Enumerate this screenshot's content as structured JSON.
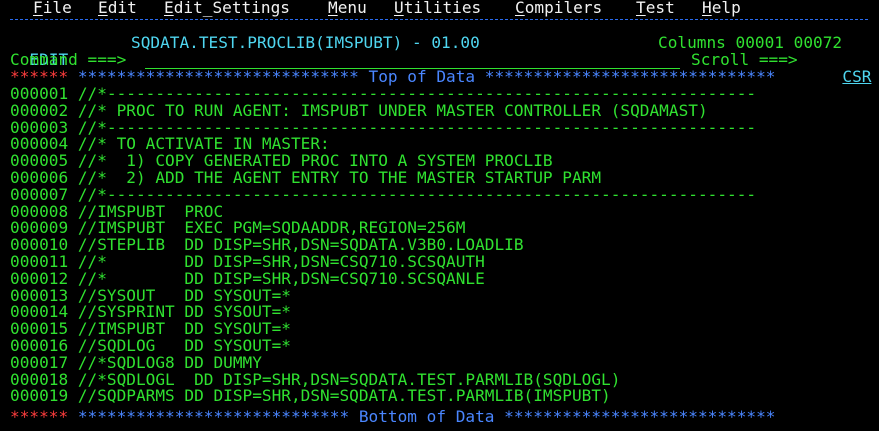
{
  "menubar": {
    "items": [
      {
        "mnemonic": "F",
        "rest": "ile"
      },
      {
        "mnemonic": "E",
        "rest": "dit"
      },
      {
        "mnemonic": "E",
        "rest": "dit_Settings"
      },
      {
        "mnemonic": "M",
        "rest": "enu"
      },
      {
        "mnemonic": "U",
        "rest": "tilities"
      },
      {
        "mnemonic": "C",
        "rest": "ompilers"
      },
      {
        "mnemonic": "T",
        "rest": "est"
      },
      {
        "mnemonic": "H",
        "rest": "elp"
      }
    ]
  },
  "header": {
    "mode": "EDIT",
    "dataset": "SQDATA.TEST.PROCLIB(IMSPUBT) - 01.00",
    "columns": "Columns 00001 00072",
    "command_label": "Command ===>",
    "command_value": "",
    "scroll_label": "Scroll ===>",
    "scroll_value": "CSR"
  },
  "markers": {
    "stars": "******",
    "top_line": " ***************************** Top of Data ******************************",
    "bottom_line": " **************************** Bottom of Data ****************************"
  },
  "lines": [
    {
      "num": "000001",
      "text": " //*-------------------------------------------------------------------"
    },
    {
      "num": "000002",
      "text": " //* PROC TO RUN AGENT: IMSPUBT UNDER MASTER CONTROLLER (SQDAMAST)"
    },
    {
      "num": "000003",
      "text": " //*-------------------------------------------------------------------"
    },
    {
      "num": "000004",
      "text": " //* TO ACTIVATE IN MASTER:"
    },
    {
      "num": "000005",
      "text": " //*  1) COPY GENERATED PROC INTO A SYSTEM PROCLIB"
    },
    {
      "num": "000006",
      "text": " //*  2) ADD THE AGENT ENTRY TO THE MASTER STARTUP PARM"
    },
    {
      "num": "000007",
      "text": " //*-------------------------------------------------------------------"
    },
    {
      "num": "000008",
      "text": " //IMSPUBT  PROC"
    },
    {
      "num": "000009",
      "text": " //IMSPUBT  EXEC PGM=SQDAADDR,REGION=256M"
    },
    {
      "num": "000010",
      "text": " //STEPLIB  DD DISP=SHR,DSN=SQDATA.V3B0.LOADLIB"
    },
    {
      "num": "000011",
      "text": " //*        DD DISP=SHR,DSN=CSQ710.SCSQAUTH"
    },
    {
      "num": "000012",
      "text": " //*        DD DISP=SHR,DSN=CSQ710.SCSQANLE"
    },
    {
      "num": "000013",
      "text": " //SYSOUT   DD SYSOUT=*"
    },
    {
      "num": "000014",
      "text": " //SYSPRINT DD SYSOUT=*"
    },
    {
      "num": "000015",
      "text": " //IMSPUBT  DD SYSOUT=*"
    },
    {
      "num": "000016",
      "text": " //SQDLOG   DD SYSOUT=*"
    },
    {
      "num": "000017",
      "text": " //*SQDLOG8 DD DUMMY"
    },
    {
      "num": "000018",
      "text": " //*SQDLOGL  DD DISP=SHR,DSN=SQDATA.TEST.PARMLIB(SQDLOGL)"
    },
    {
      "num": "000019",
      "text": " //SQDPARMS DD DISP=SHR,DSN=SQDATA.TEST.PARMLIB(IMSPUBT)"
    }
  ],
  "colors": {
    "background": "#000000",
    "text_green": "#30e130",
    "text_cyan": "#4fd6f0",
    "marker_red": "#ff3d3d",
    "marker_blue": "#4a86ff",
    "menu_white": "#f2f2f2"
  }
}
